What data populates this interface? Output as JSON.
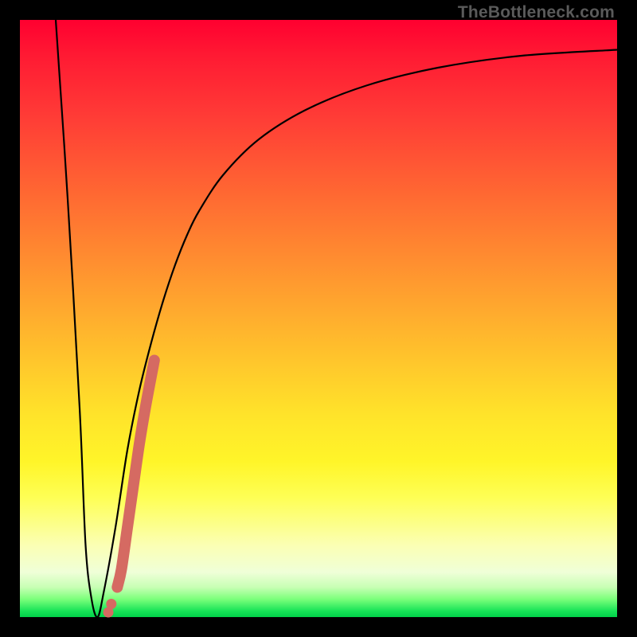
{
  "watermark": "TheBottleneck.com",
  "chart_data": {
    "type": "line",
    "title": "",
    "xlabel": "",
    "ylabel": "",
    "xlim": [
      0,
      100
    ],
    "ylim": [
      0,
      100
    ],
    "grid": false,
    "legend": false,
    "series": [
      {
        "name": "bottleneck-curve",
        "color": "#000000",
        "x": [
          6,
          8,
          10,
          11,
          12,
          13,
          14,
          16,
          18,
          20,
          22,
          24,
          26,
          28,
          30,
          34,
          40,
          48,
          58,
          70,
          84,
          100
        ],
        "y": [
          100,
          70,
          35,
          12,
          3,
          0,
          4,
          15,
          28,
          38,
          46,
          53,
          59,
          64,
          68,
          74,
          80,
          85,
          89,
          92,
          94,
          95
        ]
      },
      {
        "name": "highlight-segment",
        "color": "#d56a62",
        "style": "thick-rounded",
        "x": [
          16.3,
          17.0,
          18.0,
          19.0,
          20.0,
          21.0,
          22.5
        ],
        "y": [
          5,
          8,
          15,
          22,
          29,
          35,
          43
        ]
      },
      {
        "name": "highlight-dots",
        "color": "#d56a62",
        "style": "points",
        "x": [
          14.8,
          15.3
        ],
        "y": [
          0.8,
          2.2
        ]
      }
    ],
    "background_gradient": {
      "orientation": "vertical",
      "stops": [
        {
          "pos": 0.0,
          "color": "#ff0030"
        },
        {
          "pos": 0.3,
          "color": "#ff6b32"
        },
        {
          "pos": 0.56,
          "color": "#ffc22c"
        },
        {
          "pos": 0.74,
          "color": "#fff529"
        },
        {
          "pos": 0.9,
          "color": "#f4ffcf"
        },
        {
          "pos": 0.97,
          "color": "#7bff7b"
        },
        {
          "pos": 1.0,
          "color": "#00d149"
        }
      ]
    }
  }
}
